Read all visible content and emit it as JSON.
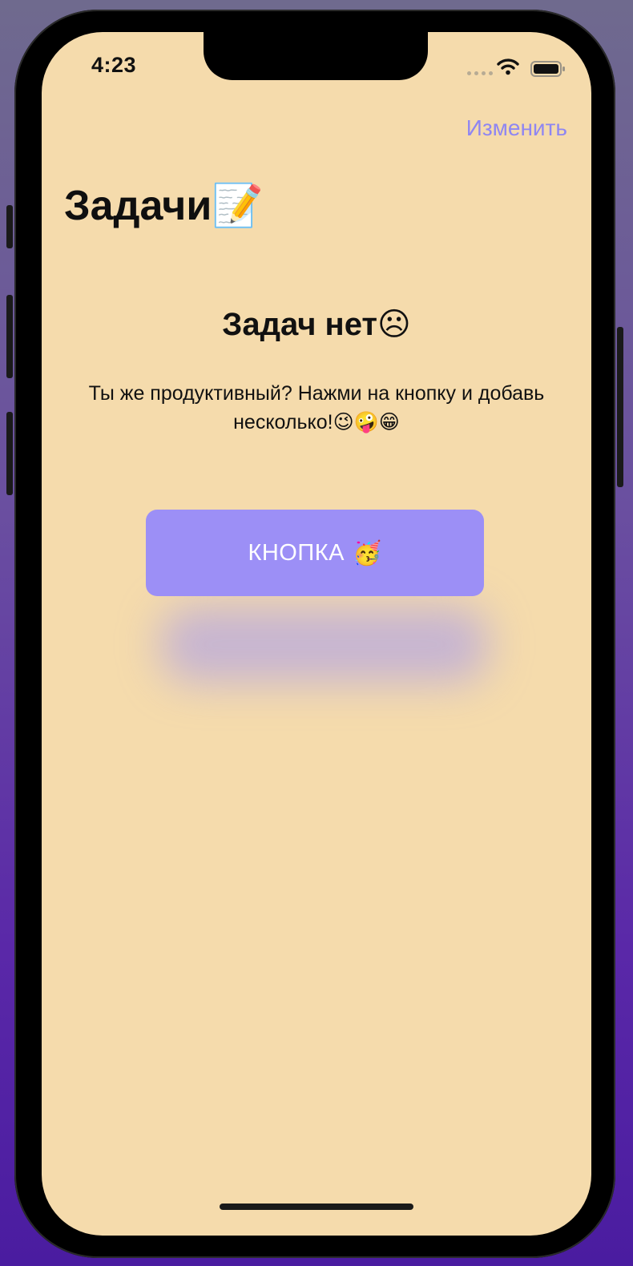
{
  "status_bar": {
    "time": "4:23",
    "icons": [
      "signal-dots-icon",
      "wifi-icon",
      "battery-icon"
    ]
  },
  "nav": {
    "edit_label": "Изменить"
  },
  "header": {
    "title": "Задачи",
    "title_emoji": "📝"
  },
  "empty_state": {
    "title": "Задач нет",
    "title_emoji": "☹",
    "description": "Ты же продуктивный? Нажми на кнопку и добавь несколько!",
    "description_emojis": "😉🤪😁"
  },
  "action": {
    "button_label": "КНОПКА",
    "button_emoji": "🥳"
  },
  "colors": {
    "background": "#f5dbac",
    "accent": "#9c8ff6",
    "edit_link": "#8f86f2",
    "text": "#111111"
  }
}
